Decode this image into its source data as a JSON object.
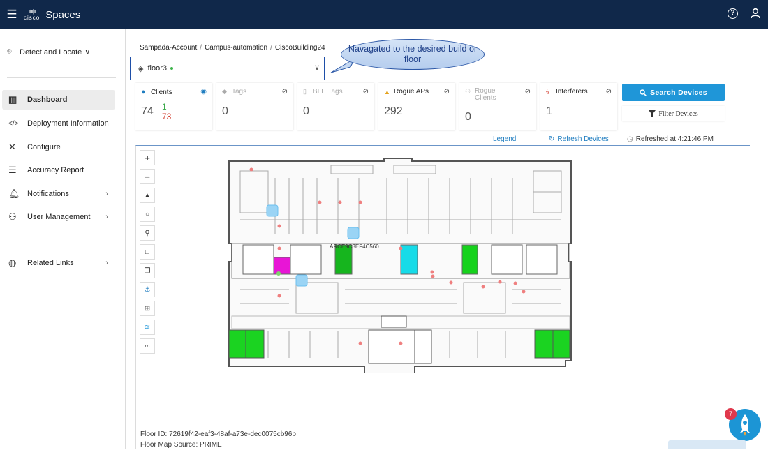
{
  "app": {
    "title": "Spaces",
    "logo_text": "cisco"
  },
  "sidebar": {
    "header": {
      "label": "Detect and Locate"
    },
    "items": [
      {
        "label": "Dashboard",
        "icon": "dashboard-icon"
      },
      {
        "label": "Deployment Information",
        "icon": "code-icon"
      },
      {
        "label": "Configure",
        "icon": "tools-icon"
      },
      {
        "label": "Accuracy Report",
        "icon": "report-icon"
      },
      {
        "label": "Notifications",
        "icon": "bell-icon"
      },
      {
        "label": "User Management",
        "icon": "user-icon"
      }
    ],
    "related": {
      "label": "Related Links",
      "icon": "globe-icon"
    }
  },
  "breadcrumb": [
    "Sampada-Account",
    "Campus-automation",
    "CiscoBuilding24"
  ],
  "floor_select": {
    "value": "floor3"
  },
  "callout": {
    "text": "Navagated to the desired build or floor"
  },
  "stats": {
    "clients": {
      "label": "Clients",
      "value": "74",
      "sub1": "1",
      "sub2": "73"
    },
    "tags": {
      "label": "Tags",
      "value": "0"
    },
    "ble_tags": {
      "label": "BLE Tags",
      "value": "0"
    },
    "rogue_aps": {
      "label": "Rogue APs",
      "value": "292"
    },
    "rogue_clients": {
      "label": "Rogue Clients",
      "value": "0"
    },
    "interferers": {
      "label": "Interferers",
      "value": "1"
    }
  },
  "buttons": {
    "search": "Search Devices",
    "filter": "Filter Devices"
  },
  "map_header": {
    "legend": "Legend",
    "refresh": "Refresh Devices",
    "refreshed": "Refreshed at 4:21:46 PM"
  },
  "map": {
    "ap_label": "ARCE9C3EF4C560"
  },
  "floor_info": {
    "id": "Floor ID: 72619f42-eaf3-48af-a73e-dec0075cb96b",
    "source": "Floor Map Source: PRIME"
  },
  "assistant": {
    "badge": "7"
  },
  "colors": {
    "topbar": "#10284a",
    "accent": "#1f96d8",
    "callout_border": "#2a56a6"
  }
}
